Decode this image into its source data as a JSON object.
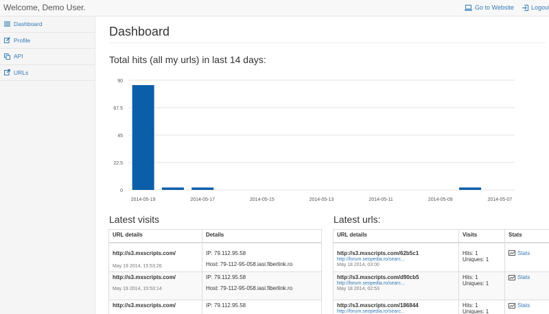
{
  "navbar": {
    "brand": "Welcome, Demo User.",
    "go_to_website": "Go to Website",
    "logout": "Logout",
    "go_icon": "laptop-icon",
    "logout_icon": "logout-icon"
  },
  "sidebar": {
    "items": [
      {
        "label": "Dashboard",
        "icon": "menu-icon"
      },
      {
        "label": "Profile",
        "icon": "edit-icon"
      },
      {
        "label": "API",
        "icon": "copy-icon"
      },
      {
        "label": "URLs",
        "icon": "external-link-icon"
      }
    ]
  },
  "main": {
    "title": "Dashboard",
    "chart_heading": "Total hits (all my urls) in last 14 days:",
    "visits_heading": "Latest visits",
    "urls_heading": "Latest urls:"
  },
  "chart_data": {
    "type": "bar",
    "title": "",
    "xlabel": "",
    "ylabel": "",
    "ylim": [
      0,
      90
    ],
    "yticks": [
      "90",
      "67.5",
      "45",
      "22.5",
      "0"
    ],
    "ytick_values": [
      90,
      67.5,
      45,
      22.5,
      0
    ],
    "xtick_labels": [
      "2014-05-19",
      "2014-05-17",
      "2014-05-15",
      "2014-05-13",
      "2014-05-11",
      "2014-05-09",
      "2014-05-07"
    ],
    "categories": [
      "2014-05-19",
      "2014-05-18",
      "2014-05-17",
      "2014-05-16",
      "2014-05-15",
      "2014-05-14",
      "2014-05-13",
      "2014-05-12",
      "2014-05-11",
      "2014-05-10",
      "2014-05-09",
      "2014-05-08",
      "2014-05-07"
    ],
    "values": [
      86,
      2,
      2,
      0,
      0,
      0,
      0,
      0,
      0,
      0,
      0,
      2,
      0
    ],
    "grid": true,
    "bar_color": "#0b5ea8"
  },
  "visits_table": {
    "headers": [
      "URL details",
      "Details"
    ],
    "rows": [
      {
        "url": "http://s3.mxscripts.com/",
        "date": "May 19 2014, 15:53:26",
        "ip": "IP: 79.112.95.58",
        "host": "Host: 79-112-95-058.iasi.fiberlink.ro"
      },
      {
        "url": "http://s3.mxscripts.com/",
        "date": "May 19 2014, 15:53:14",
        "ip": "IP: 79.112.95.58",
        "host": "Host: 79-112-95-058.iasi.fiberlink.ro"
      },
      {
        "url": "http://s3.mxscripts.com/",
        "date": "",
        "ip": "IP: 79.112.95.58",
        "host": ""
      }
    ]
  },
  "urls_table": {
    "headers": [
      "URL details",
      "Visits",
      "Stats"
    ],
    "stats_label": "Stats",
    "stats_icon": "chart-icon",
    "rows": [
      {
        "url": "http://s3.mxscripts.com/62b5c1",
        "source": "http://forum.seopedia.ro/searc...",
        "date": "May 18 2014, 03:00",
        "hits": "Hits: 1",
        "uniques": "Uniques: 1"
      },
      {
        "url": "http://s3.mxscripts.com/d90cb5",
        "source": "http://forum.seopedia.ro/searc...",
        "date": "May 18 2014, 02:53",
        "hits": "Hits: 1",
        "uniques": "Uniques: 1"
      },
      {
        "url": "http://s3.mxscripts.com/186844",
        "source": "http://forum.seopedia.ro/searc...",
        "date": "",
        "hits": "Hits: 1",
        "uniques": "Uniques: 1"
      }
    ]
  }
}
